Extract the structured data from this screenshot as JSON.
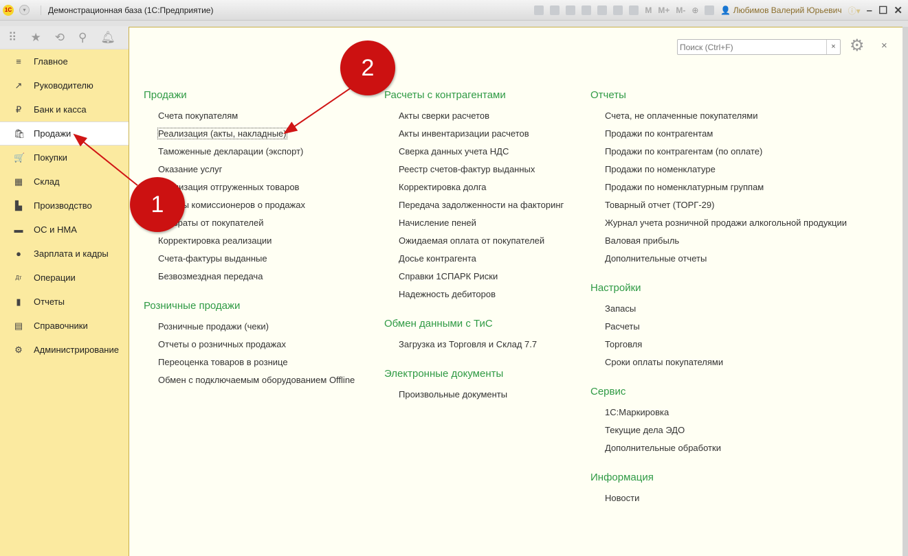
{
  "window": {
    "title": "Демонстрационная база  (1С:Предприятие)",
    "user": "Любимов Валерий Юрьевич",
    "logo": "1С"
  },
  "toolbar": {
    "m": "M",
    "mplus": "M+",
    "mminus": "M-"
  },
  "sidebar": {
    "items": [
      {
        "label": "Главное",
        "icon": "menu-icon",
        "glyph": "≡"
      },
      {
        "label": "Руководителю",
        "icon": "trend-icon",
        "glyph": "↗"
      },
      {
        "label": "Банк и касса",
        "icon": "ruble-icon",
        "glyph": "₽"
      },
      {
        "label": "Продажи",
        "icon": "bag-icon",
        "glyph": "🛍"
      },
      {
        "label": "Покупки",
        "icon": "cart-icon",
        "glyph": "🛒"
      },
      {
        "label": "Склад",
        "icon": "warehouse-icon",
        "glyph": "▦"
      },
      {
        "label": "Производство",
        "icon": "factory-icon",
        "glyph": "▙"
      },
      {
        "label": "ОС и НМА",
        "icon": "truck-icon",
        "glyph": "▬"
      },
      {
        "label": "Зарплата и кадры",
        "icon": "person-icon",
        "glyph": "●"
      },
      {
        "label": "Операции",
        "icon": "dt-kt-icon",
        "glyph": "Дт"
      },
      {
        "label": "Отчеты",
        "icon": "bar-chart-icon",
        "glyph": "▮"
      },
      {
        "label": "Справочники",
        "icon": "book-icon",
        "glyph": "▤"
      },
      {
        "label": "Администрирование",
        "icon": "gear-icon",
        "glyph": "⚙"
      }
    ]
  },
  "search": {
    "placeholder": "Поиск (Ctrl+F)",
    "clear": "×"
  },
  "close": "×",
  "columns": [
    {
      "sections": [
        {
          "title": "Продажи",
          "links": [
            "Счета покупателям",
            "Реализация (акты, накладные)",
            "Таможенные декларации (экспорт)",
            "Оказание услуг",
            "Реализация отгруженных товаров",
            "Отчеты комиссионеров о продажах",
            "Возвраты от покупателей",
            "Корректировка реализации",
            "Счета-фактуры выданные",
            "Безвозмездная передача"
          ]
        },
        {
          "title": "Розничные продажи",
          "links": [
            "Розничные продажи (чеки)",
            "Отчеты о розничных продажах",
            "Переоценка товаров в рознице",
            "Обмен с подключаемым оборудованием Offline"
          ]
        }
      ]
    },
    {
      "sections": [
        {
          "title": "Расчеты с контрагентами",
          "links": [
            "Акты сверки расчетов",
            "Акты инвентаризации расчетов",
            "Сверка данных учета НДС",
            "Реестр счетов-фактур выданных",
            "Корректировка долга",
            "Передача задолженности на факторинг",
            "Начисление пеней",
            "Ожидаемая оплата от покупателей",
            "Досье контрагента",
            "Справки 1СПАРК Риски",
            "Надежность дебиторов"
          ]
        },
        {
          "title": "Обмен данными с ТиС",
          "links": [
            "Загрузка из Торговля и Склад 7.7"
          ]
        },
        {
          "title": "Электронные документы",
          "links": [
            "Произвольные документы"
          ]
        }
      ]
    },
    {
      "sections": [
        {
          "title": "Отчеты",
          "links": [
            "Счета, не оплаченные покупателями",
            "Продажи по контрагентам",
            "Продажи по контрагентам (по оплате)",
            "Продажи по номенклатуре",
            "Продажи по номенклатурным группам",
            "Товарный отчет (ТОРГ-29)",
            "Журнал учета розничной продажи алкогольной продукции",
            "Валовая прибыль",
            "Дополнительные отчеты"
          ]
        },
        {
          "title": "Настройки",
          "links": [
            "Запасы",
            "Расчеты",
            "Торговля",
            "Сроки оплаты покупателями"
          ]
        },
        {
          "title": "Сервис",
          "links": [
            "1С:Маркировка",
            "Текущие дела ЭДО",
            "Дополнительные обработки"
          ]
        },
        {
          "title": "Информация",
          "links": [
            "Новости"
          ]
        }
      ]
    }
  ],
  "annotations": [
    {
      "label": "1"
    },
    {
      "label": "2"
    }
  ],
  "colors": {
    "accent": "#2f9a45",
    "sidebar": "#fbeaa0",
    "marker": "#cc1111"
  }
}
